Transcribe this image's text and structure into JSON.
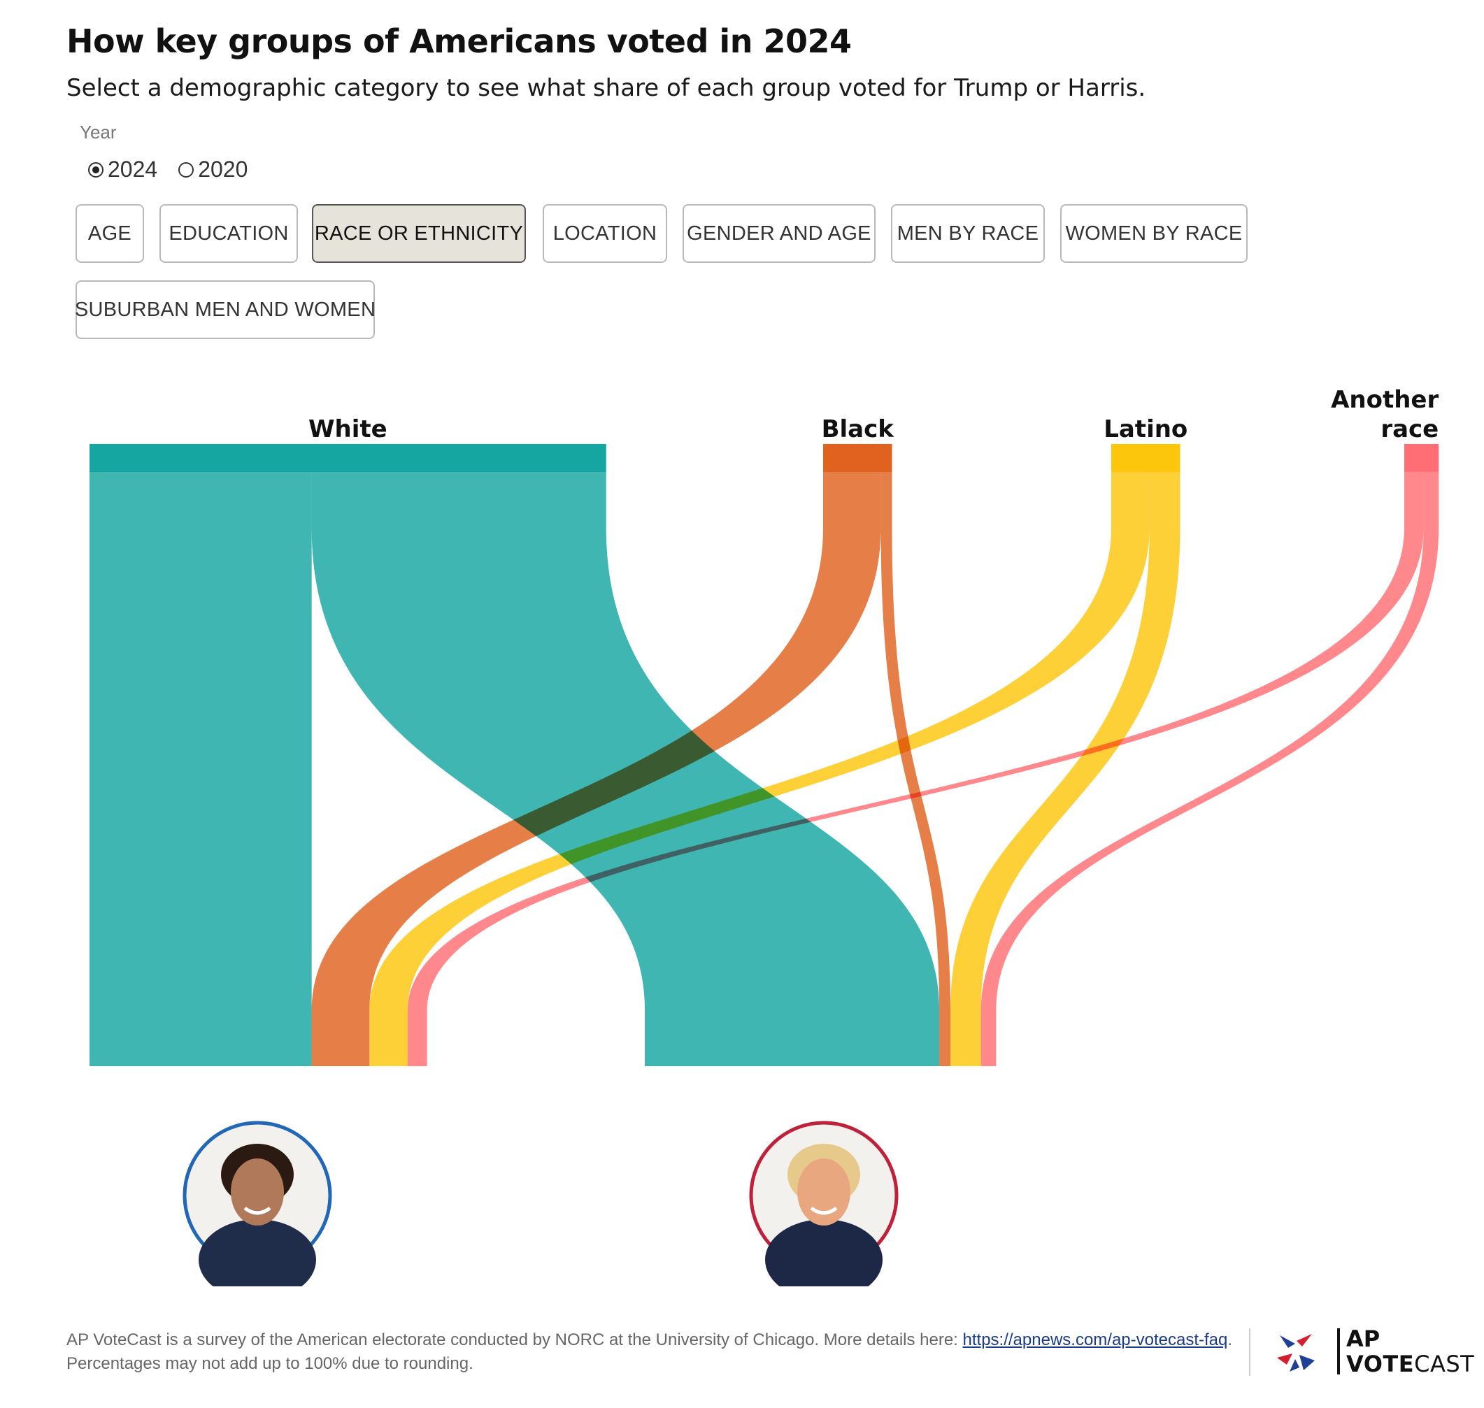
{
  "title": "How key groups of Americans voted in 2024",
  "subtitle": "Select a demographic category to see what share of each group voted for Trump or Harris.",
  "year_selector": {
    "label": "Year",
    "options": [
      {
        "label": "2024",
        "selected": true
      },
      {
        "label": "2020",
        "selected": false
      }
    ]
  },
  "categories": [
    {
      "label": "AGE",
      "active": false
    },
    {
      "label": "EDUCATION",
      "active": false
    },
    {
      "label": "RACE OR ETHNICITY",
      "active": true
    },
    {
      "label": "LOCATION",
      "active": false
    },
    {
      "label": "GENDER AND AGE",
      "active": false
    },
    {
      "label": "MEN BY RACE",
      "active": false
    },
    {
      "label": "WOMEN BY RACE",
      "active": false
    },
    {
      "label": "SUBURBAN MEN AND WOMEN",
      "active": false
    }
  ],
  "chart_data": {
    "type": "sankey",
    "title": "How key groups of Americans voted in 2024",
    "sources": [
      "White",
      "Black",
      "Latino",
      "Another race"
    ],
    "targets": [
      "Harris",
      "Trump"
    ],
    "source_colors": {
      "White": "#16a6a2",
      "Black": "#e0621e",
      "Latino": "#fcc60c",
      "Another race": "#ff6e74"
    },
    "target_colors": {
      "Harris": "#2166b8",
      "Trump": "#c0213a"
    },
    "series": [
      {
        "name": "White",
        "share_of_electorate": 75,
        "Harris": 43,
        "Trump": 57
      },
      {
        "name": "Black",
        "share_of_electorate": 10,
        "Harris": 83,
        "Trump": 16
      },
      {
        "name": "Latino",
        "share_of_electorate": 10,
        "Harris": 55,
        "Trump": 44
      },
      {
        "name": "Another race",
        "share_of_electorate": 5,
        "Harris": 55,
        "Trump": 43
      }
    ],
    "candidate_icons": [
      "harris-portrait",
      "trump-portrait"
    ]
  },
  "footer": {
    "text": "AP VoteCast is a survey of the American electorate conducted by NORC at the University of Chicago. More details here: ",
    "link_text": "https://apnews.com/ap-votecast-faq",
    "text_after": ".",
    "note": "Percentages may not add up to 100% due to rounding."
  },
  "logo": {
    "line1": "AP",
    "line2_bold": "VOTE",
    "line2_regular": "CAST",
    "icon": "ap-votecast-star-icon"
  }
}
